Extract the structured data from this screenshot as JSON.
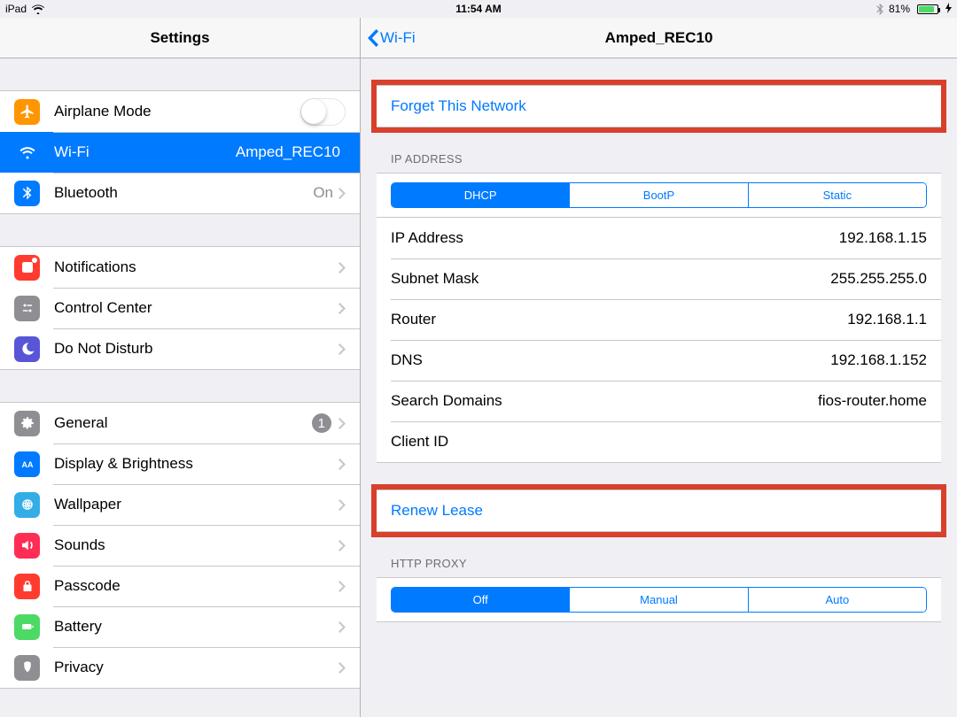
{
  "status": {
    "device": "iPad",
    "time": "11:54 AM",
    "battery_pct": "81%"
  },
  "master": {
    "title": "Settings",
    "airplane": "Airplane Mode",
    "wifi": {
      "label": "Wi-Fi",
      "value": "Amped_REC10"
    },
    "bluetooth": {
      "label": "Bluetooth",
      "value": "On"
    },
    "notifications": "Notifications",
    "control_center": "Control Center",
    "dnd": "Do Not Disturb",
    "general": {
      "label": "General",
      "badge": "1"
    },
    "display": "Display & Brightness",
    "wallpaper": "Wallpaper",
    "sounds": "Sounds",
    "passcode": "Passcode",
    "battery": "Battery",
    "privacy": "Privacy"
  },
  "detail": {
    "back": "Wi-Fi",
    "title": "Amped_REC10",
    "forget": "Forget This Network",
    "ip_section": "IP ADDRESS",
    "seg_ip": [
      "DHCP",
      "BootP",
      "Static"
    ],
    "rows": {
      "ip": {
        "k": "IP Address",
        "v": "192.168.1.15"
      },
      "mask": {
        "k": "Subnet Mask",
        "v": "255.255.255.0"
      },
      "router": {
        "k": "Router",
        "v": "192.168.1.1"
      },
      "dns": {
        "k": "DNS",
        "v": "192.168.1.152"
      },
      "search": {
        "k": "Search Domains",
        "v": "fios-router.home"
      },
      "client": {
        "k": "Client ID",
        "v": ""
      }
    },
    "renew": "Renew Lease",
    "proxy_section": "HTTP PROXY",
    "seg_proxy": [
      "Off",
      "Manual",
      "Auto"
    ]
  }
}
